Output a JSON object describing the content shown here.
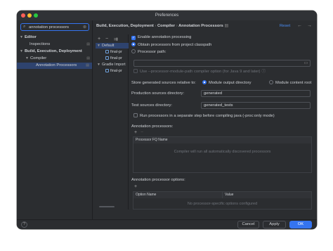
{
  "window": {
    "title": "Preferences"
  },
  "sidebar": {
    "search_value": "annotation processors",
    "items": [
      {
        "label": "Editor"
      },
      {
        "label": "Inspections"
      },
      {
        "label": "Build, Execution, Deployment"
      },
      {
        "label": "Compiler"
      },
      {
        "label": "Annotation Processors"
      }
    ]
  },
  "breadcrumb": {
    "part1": "Build, Execution, Deployment",
    "part2": "Compiler",
    "part3": "Annotation Processors",
    "sep": "›"
  },
  "header": {
    "reset_label": "Reset"
  },
  "profiles": {
    "add_icon": "+",
    "remove_icon": "−",
    "move_icon": "⇉",
    "items": [
      {
        "label": "Default"
      },
      {
        "label": "final-pr"
      },
      {
        "label": "final-pr"
      },
      {
        "label": "Gradle Import"
      },
      {
        "label": "final-pr"
      }
    ]
  },
  "settings": {
    "enable_label": "Enable annotation processing",
    "obtain_classpath_label": "Obtain processors from project classpath",
    "processor_path_label": "Processor path:",
    "module_path_label": "Use --processor-module-path compiler option (for Java 9 and later)",
    "store_relative_label": "Store generated sources relative to:",
    "module_output_label": "Module output directory",
    "module_content_label": "Module content root",
    "production_dir_label": "Production sources directory:",
    "production_dir_value": "generated",
    "test_dir_label": "Test sources directory:",
    "test_dir_value": "generated_tests",
    "proc_only_label": "Run processors in a separate step before compiling java (-proc:only mode)",
    "processors_label": "Annotation processors:",
    "processors_col": "Processor FQ Name",
    "processors_empty": "Compiler will run all automatically discovered processors",
    "options_label": "Annotation processor options:",
    "options_col_name": "Option Name",
    "options_col_value": "Value",
    "options_empty": "No processor-specific options configured"
  },
  "footer": {
    "help_label": "?",
    "cancel_label": "Cancel",
    "apply_label": "Apply",
    "ok_label": "OK"
  },
  "colors": {
    "accent": "#3574f0",
    "selection": "#2e436e",
    "link": "#4a8ef8"
  }
}
